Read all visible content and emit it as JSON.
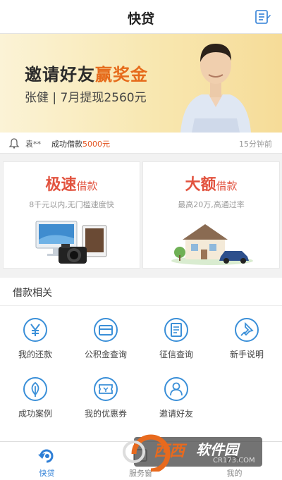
{
  "header": {
    "title": "快贷"
  },
  "banner": {
    "line1_prefix": "邀请好友",
    "line1_highlight": "赢奖金",
    "line2": "张健 | 7月提现2560元"
  },
  "notice": {
    "user": "袁**",
    "message": "成功借款",
    "amount": "5000元",
    "time": "15分钟前"
  },
  "cards": [
    {
      "big": "极速",
      "small": "借款",
      "subtitle": "8千元以内,无门槛速度快"
    },
    {
      "big": "大额",
      "small": "借款",
      "subtitle": "最高20万,高通过率"
    }
  ],
  "section": {
    "title": "借款相关",
    "items": [
      {
        "label": "我的还款",
        "icon": "yen-icon"
      },
      {
        "label": "公积金查询",
        "icon": "card-icon"
      },
      {
        "label": "征信查询",
        "icon": "document-icon"
      },
      {
        "label": "新手说明",
        "icon": "pushpin-icon"
      },
      {
        "label": "成功案例",
        "icon": "leaf-icon"
      },
      {
        "label": "我的优惠券",
        "icon": "coupon-icon"
      },
      {
        "label": "邀请好友",
        "icon": "person-icon"
      }
    ]
  },
  "tabbar": {
    "tabs": [
      {
        "label": "快贷",
        "active": true
      },
      {
        "label": "服务窗",
        "active": false
      },
      {
        "label": "我的",
        "active": false
      }
    ]
  },
  "watermark": {
    "brand": "西西",
    "brand2": "软件园",
    "url": "CR173.COM"
  },
  "colors": {
    "accent": "#2f7fd6",
    "highlight": "#e66b1b",
    "red": "#e2533f"
  }
}
